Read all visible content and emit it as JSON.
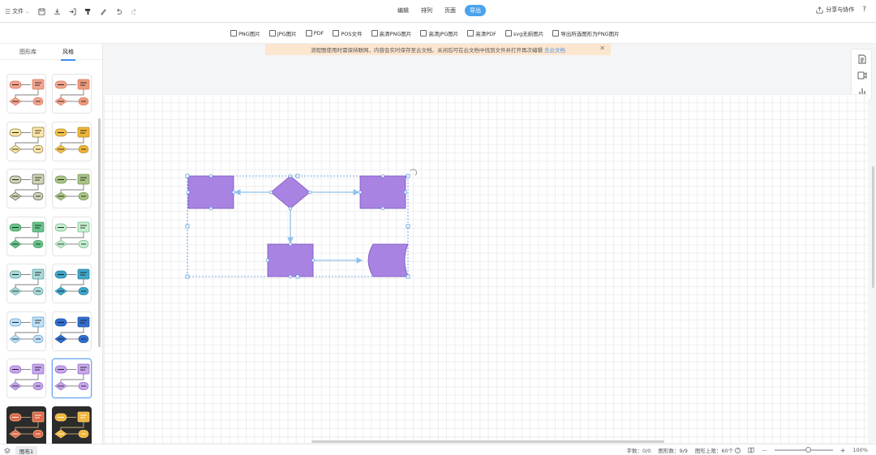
{
  "topbar": {
    "file_label": "文件",
    "menu_tabs": [
      {
        "label": "编辑",
        "active": false
      },
      {
        "label": "排列",
        "active": false
      },
      {
        "label": "页面",
        "active": false
      },
      {
        "label": "导出",
        "active": true
      }
    ],
    "share_label": "分享与协作",
    "help_label": "?"
  },
  "export_options": [
    {
      "label": "PNG图片",
      "icon": "image-icon"
    },
    {
      "label": "JPG图片",
      "icon": "image-icon"
    },
    {
      "label": "PDF",
      "icon": "pdf-icon"
    },
    {
      "label": "POS文件",
      "icon": "pos-icon"
    },
    {
      "label": "高清PNG图片",
      "icon": "image-icon"
    },
    {
      "label": "高清JPG图片",
      "icon": "image-icon"
    },
    {
      "label": "高清PDF",
      "icon": "pdf-icon"
    },
    {
      "label": "svg无损图片",
      "icon": "svg-icon"
    },
    {
      "label": "导出所选图形为PNG图片",
      "icon": "image-icon"
    }
  ],
  "notice": {
    "text": "流程图使用时需保持联网，内容会实时保存至云文档。关闭后可在云文档中找到文件并打开再次编辑",
    "link": "去云文档",
    "close": "✕"
  },
  "left_panel": {
    "tabs": [
      {
        "label": "图形库",
        "active": false
      },
      {
        "label": "风格",
        "active": true
      }
    ],
    "themes": [
      {
        "fill": "#f2a48f",
        "stroke": "#d9745a",
        "alt": "#f2a48f",
        "dark": false,
        "selected": false
      },
      {
        "fill": "#f2a48f",
        "stroke": "#d9745a",
        "alt": "#ee9a7c",
        "dark": false,
        "selected": false
      },
      {
        "fill": "#fbe6a8",
        "stroke": "#8a7a3a",
        "alt": "#fbe6a8",
        "dark": false,
        "selected": false
      },
      {
        "fill": "#f4c04a",
        "stroke": "#b08a20",
        "alt": "#f0b43a",
        "dark": false,
        "selected": false
      },
      {
        "fill": "#cfd4b3",
        "stroke": "#555555",
        "alt": "#cfd4b3",
        "dark": false,
        "selected": false
      },
      {
        "fill": "#a9c486",
        "stroke": "#6f8d50",
        "alt": "#a9c486",
        "dark": false,
        "selected": false
      },
      {
        "fill": "#67c28a",
        "stroke": "#3f9a63",
        "alt": "#67c28a",
        "dark": false,
        "selected": false
      },
      {
        "fill": "#c6efcf",
        "stroke": "#6fb484",
        "alt": "#c6efcf",
        "dark": false,
        "selected": false
      },
      {
        "fill": "#a9d9d8",
        "stroke": "#4e9a99",
        "alt": "#a9d9d8",
        "dark": false,
        "selected": false
      },
      {
        "fill": "#3fa6c8",
        "stroke": "#23809f",
        "alt": "#3fa6c8",
        "dark": false,
        "selected": false
      },
      {
        "fill": "#bfe0f6",
        "stroke": "#5b9fcf",
        "alt": "#bfe0f6",
        "dark": false,
        "selected": false
      },
      {
        "fill": "#2f6fd0",
        "stroke": "#1c4f9f",
        "alt": "#2f6fd0",
        "dark": false,
        "selected": false
      },
      {
        "fill": "#c7a7ec",
        "stroke": "#8e63c8",
        "alt": "#c7a7ec",
        "dark": false,
        "selected": false
      },
      {
        "fill": "#c7a7ec",
        "stroke": "#8e63c8",
        "alt": "#c7a7ec",
        "dark": false,
        "selected": true
      },
      {
        "fill": "#e0664a",
        "stroke": "#f7c08a",
        "alt": "#e0664a",
        "dark": true,
        "selected": false
      },
      {
        "fill": "#f2b537",
        "stroke": "#f7d78a",
        "alt": "#f2b537",
        "dark": true,
        "selected": false
      }
    ]
  },
  "diagram": {
    "shape_fill": "#a883e2",
    "shape_stroke": "#7a53bf",
    "connector_color": "#8fc1ea",
    "selection_color": "#4a90e2"
  },
  "statusbar": {
    "page_tab": "图布1",
    "char_count": "字数：0/0",
    "shape_count": "图形数：9/9",
    "shape_limit": "图形上限：60个",
    "zoom_minus": "—",
    "zoom_plus": "+",
    "zoom_level": "100%",
    "zoom_fraction": 0.58
  }
}
